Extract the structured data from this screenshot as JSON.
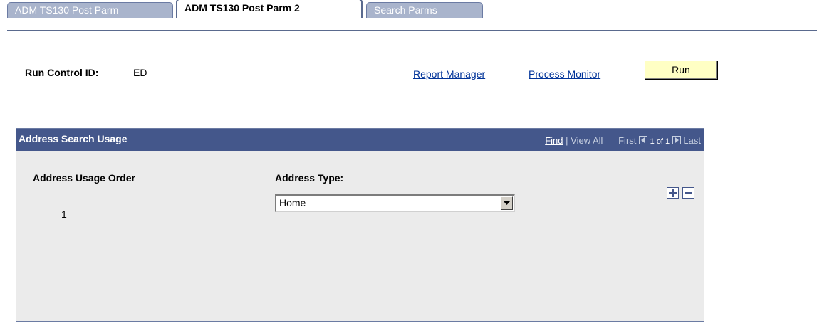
{
  "tabs": [
    {
      "label": "ADM TS130 Post Parm",
      "active": false
    },
    {
      "label": "ADM TS130 Post Parm 2",
      "active": true
    },
    {
      "label": "Search Parms",
      "active": false
    }
  ],
  "run_control": {
    "label": "Run Control ID:",
    "value": "ED"
  },
  "links": {
    "report_manager": "Report Manager",
    "process_monitor": "Process Monitor"
  },
  "run_button": {
    "label": "Run"
  },
  "grid": {
    "title": "Address Search Usage",
    "nav": {
      "find": "Find",
      "separator": "|",
      "view_all": "View All",
      "first": "First",
      "position": "1 of 1",
      "last": "Last"
    },
    "columns": {
      "order": "Address Usage Order",
      "type": "Address Type:"
    },
    "rows": [
      {
        "order": "1",
        "type": "Home"
      }
    ]
  },
  "colors": {
    "header_bg": "#44578b",
    "run_button_bg": "#ffffc4",
    "link": "#003399",
    "grid_bg": "#ebebeb"
  },
  "icons": {
    "add_row": "plus-icon",
    "delete_row": "minus-icon",
    "dropdown": "chevron-down-icon",
    "prev": "arrow-left-icon",
    "next": "arrow-right-icon"
  }
}
